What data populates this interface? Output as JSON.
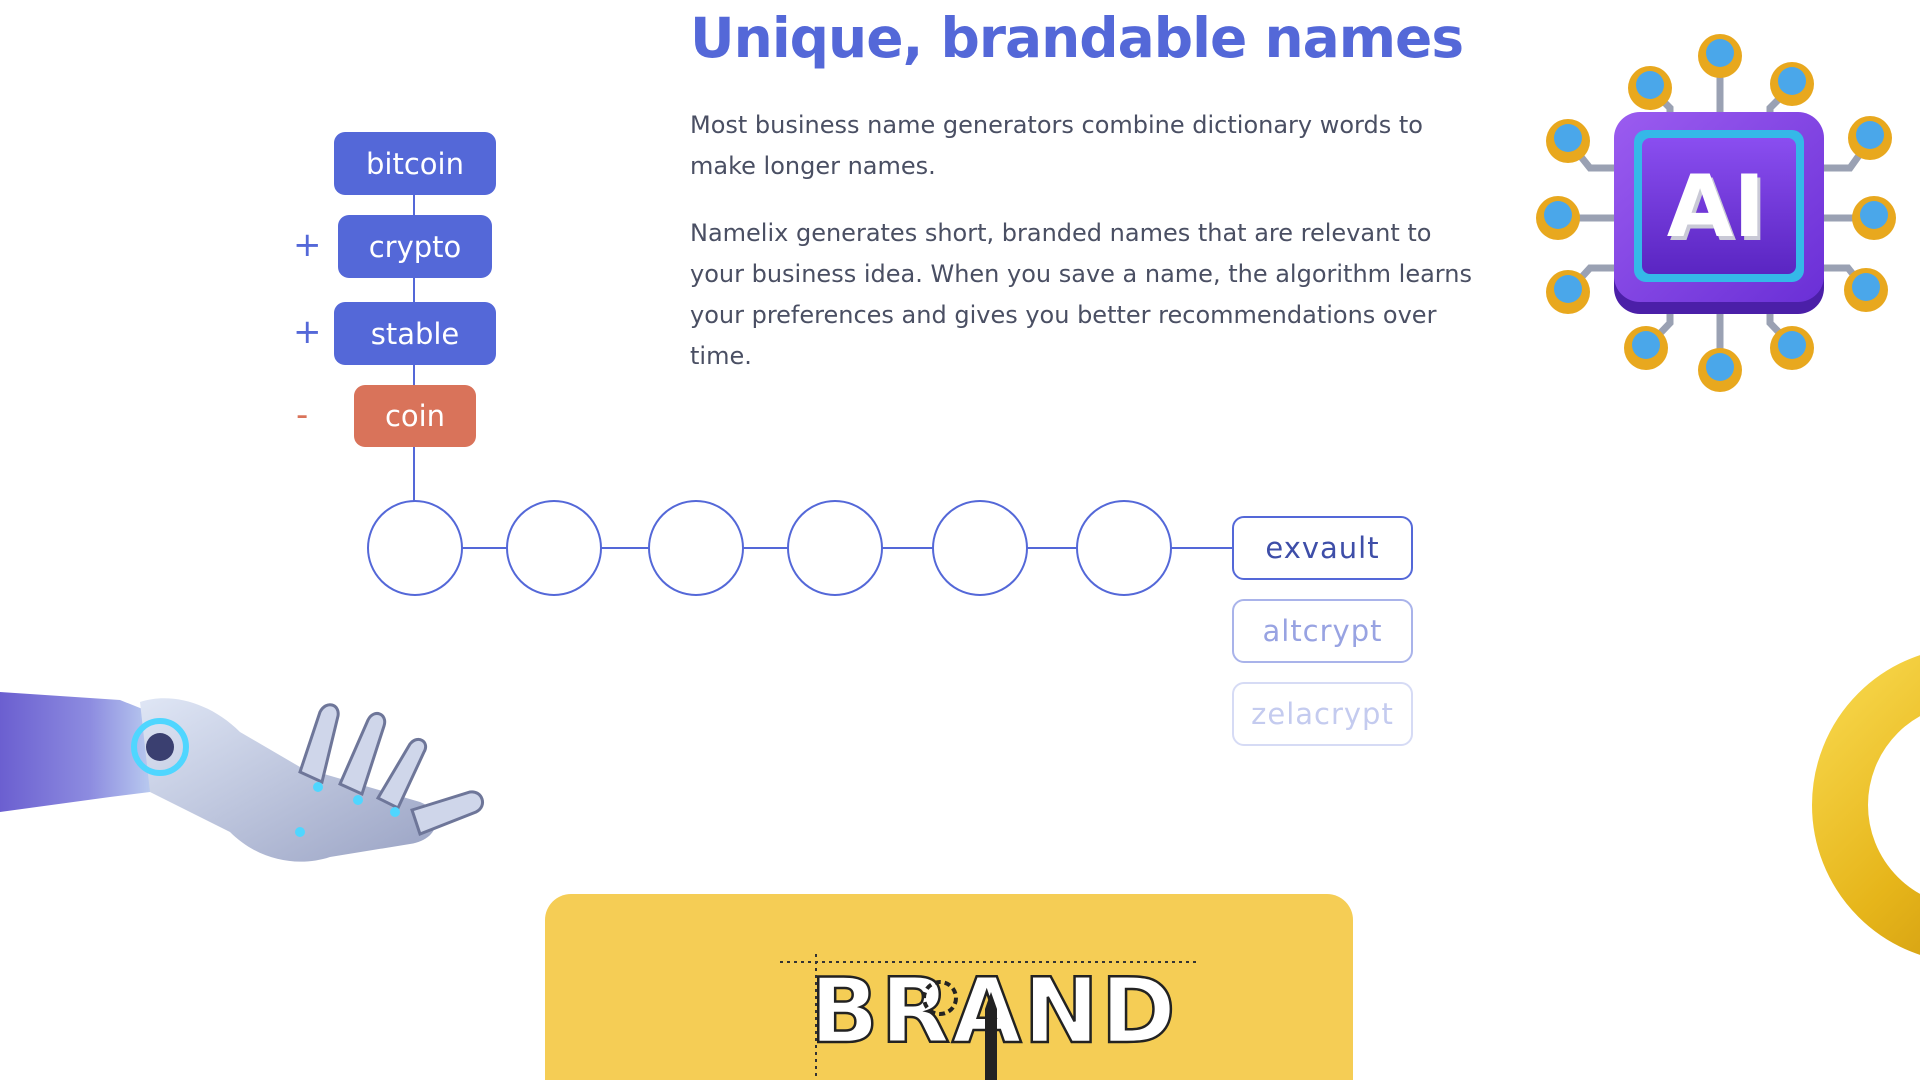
{
  "section": {
    "title": "Unique, brandable names",
    "paragraphs": [
      "Most business name generators combine dictionary words to make longer names.",
      "Namelix generates short, branded names that are relevant to your business idea. When you save a name, the algorithm learns your preferences and gives you better recommendations over time."
    ]
  },
  "diagram": {
    "words": [
      {
        "label": "bitcoin",
        "operator": ""
      },
      {
        "label": "crypto",
        "operator": "+"
      },
      {
        "label": "stable",
        "operator": "+"
      },
      {
        "label": "coin",
        "operator": "-"
      }
    ],
    "node_count": 6,
    "results": [
      "exvault",
      "altcrypt",
      "zelacrypt"
    ]
  },
  "illustrations": {
    "ai_chip": {
      "label": "AI",
      "icon": "ai-chip-icon"
    },
    "robot_hand": {
      "icon": "robot-hand-icon"
    },
    "ring": {
      "icon": "gold-ring-icon"
    },
    "brand_card": {
      "word": "BRAND"
    }
  },
  "colors": {
    "accent": "#5468d8",
    "heading": "#5468d8",
    "body_text": "#4a4f63",
    "minus": "#d9735a",
    "card": "#f5cd55"
  }
}
